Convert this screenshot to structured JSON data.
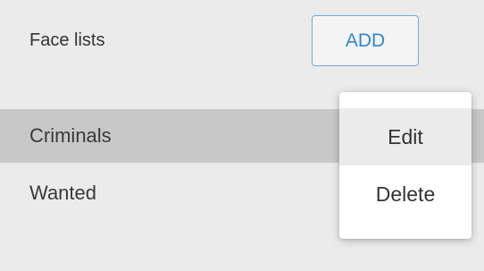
{
  "header": {
    "title": "Face lists",
    "add_label": "ADD"
  },
  "list": {
    "items": [
      {
        "label": "Criminals",
        "selected": true
      },
      {
        "label": "Wanted",
        "selected": false
      }
    ]
  },
  "context_menu": {
    "items": [
      {
        "label": "Edit",
        "highlighted": true
      },
      {
        "label": "Delete",
        "highlighted": false
      }
    ]
  },
  "colors": {
    "accent": "#2f86d8",
    "selected_row": "#c8c8c8",
    "background": "#ebebeb"
  }
}
